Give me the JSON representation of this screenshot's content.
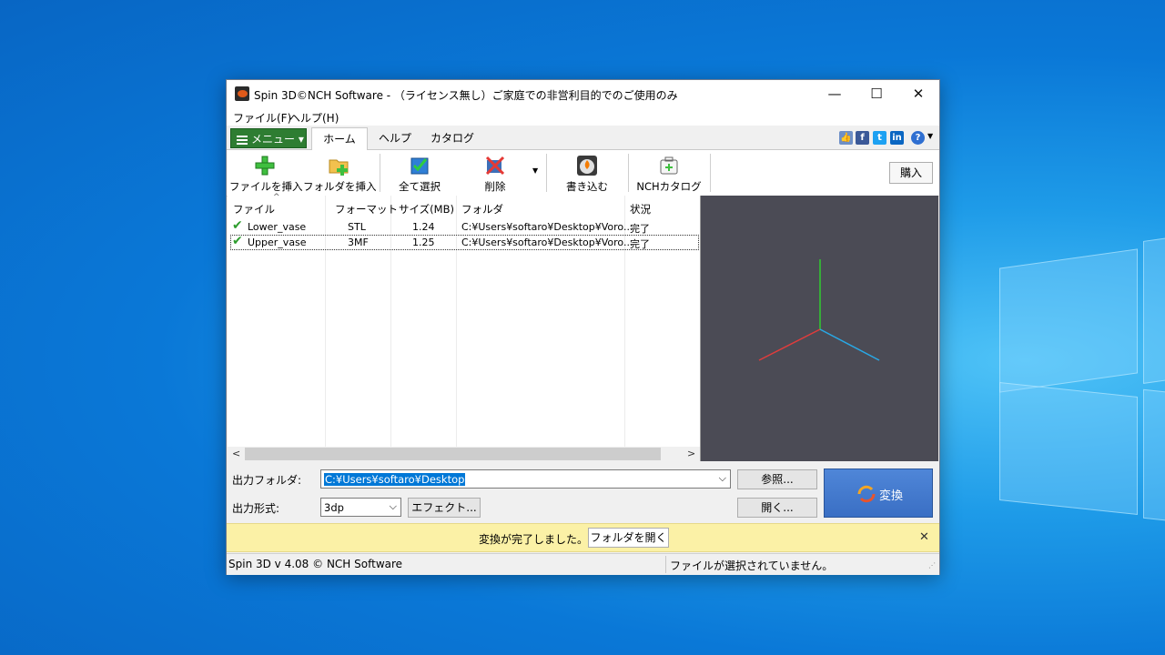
{
  "window": {
    "title": "Spin 3D©NCH Software - （ライセンス無し）ご家庭での非営利目的でのご使用のみ",
    "minimize": "—",
    "maximize": "☐",
    "close": "✕"
  },
  "menubar": {
    "file": "ファイル(F)",
    "help": "ヘルプ(H)"
  },
  "tabs": {
    "menu_button": "メニュー ▾",
    "items": [
      "ホーム",
      "ヘルプ",
      "カタログ"
    ]
  },
  "social": {
    "like": "👍",
    "facebook": "f",
    "twitter": "t",
    "linkedin": "in",
    "help": "?"
  },
  "toolbar": {
    "insert_file": "ファイルを挿入",
    "insert_folder": "フォルダを挿入",
    "select_all": "全て選択",
    "delete": "削除",
    "burn": "書き込む",
    "nch_catalog": "NCHカタログ",
    "buy": "購入"
  },
  "file_list": {
    "columns": [
      "ファイル",
      "フォーマット",
      "サイズ(MB)",
      "フォルダ",
      "状況"
    ],
    "rows": [
      {
        "file": "Lower_vase",
        "format": "STL",
        "size": "1.24",
        "folder": "C:¥Users¥softaro¥Desktop¥Voro...",
        "status": "完了"
      },
      {
        "file": "Upper_vase",
        "format": "3MF",
        "size": "1.25",
        "folder": "C:¥Users¥softaro¥Desktop¥Voro...",
        "status": "完了"
      }
    ]
  },
  "output": {
    "folder_label": "出力フォルダ:",
    "folder_value": "C:¥Users¥softaro¥Desktop",
    "browse": "参照...",
    "format_label": "出力形式:",
    "format_value": "3dp",
    "effects": "エフェクト...",
    "open": "開く...",
    "convert": "変換"
  },
  "notification": {
    "message": "変換が完了しました。",
    "open_folder": "フォルダを開く",
    "close": "✕"
  },
  "status": {
    "version": "Spin 3D v 4.08 © NCH Software",
    "selection": "ファイルが選択されていません。"
  },
  "colors": {
    "menu_green": "#2e7d32",
    "preview_bg": "#4b4b55",
    "axis_x": "#e03c3c",
    "axis_y": "#2fcc2f",
    "axis_z": "#29a8e6",
    "notice_bg": "#fbf1a6",
    "convert_blue": "#3a6fc4"
  }
}
